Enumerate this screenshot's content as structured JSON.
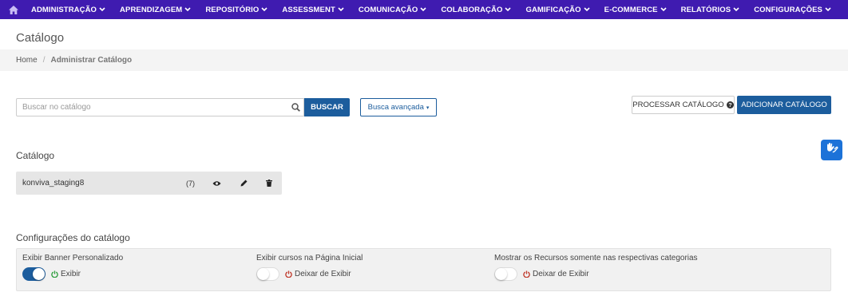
{
  "nav": {
    "items": [
      {
        "label": "ADMINISTRAÇÃO"
      },
      {
        "label": "APRENDIZAGEM"
      },
      {
        "label": "REPOSITÓRIO"
      },
      {
        "label": "ASSESSMENT"
      },
      {
        "label": "COMUNICAÇÃO"
      },
      {
        "label": "COLABORAÇÃO"
      },
      {
        "label": "GAMIFICAÇÃO"
      },
      {
        "label": "E-COMMERCE"
      },
      {
        "label": "RELATÓRIOS"
      },
      {
        "label": "CONFIGURAÇÕES"
      }
    ]
  },
  "page": {
    "title": "Catálogo"
  },
  "breadcrumb": {
    "home": "Home",
    "separator": "/",
    "current": "Administrar Catálogo"
  },
  "search": {
    "placeholder": "Buscar no catálogo",
    "value": "",
    "button_label": "BUSCAR",
    "advanced_label": "Busca avançada",
    "advanced_caret": "▾"
  },
  "actions": {
    "process_label": "PROCESSAR CATÁLOGO",
    "add_label": "ADICIONAR CATÁLOGO"
  },
  "catalog": {
    "section_title": "Catálogo",
    "items": [
      {
        "name": "konviva_staging8",
        "count": "(7)"
      }
    ]
  },
  "settings": {
    "section_title": "Configurações do catálogo",
    "items": [
      {
        "label": "Exibir Banner Personalizado",
        "state": "on",
        "state_label": "Exibir"
      },
      {
        "label": "Exibir cursos na Página Inicial",
        "state": "off",
        "state_label": "Deixar de Exibir"
      },
      {
        "label": "Mostrar os Recursos somente nas respectivas categorias",
        "state": "off",
        "state_label": "Deixar de Exibir"
      }
    ]
  },
  "colors": {
    "nav_bg": "#3f1bb0",
    "primary": "#1c5d9d",
    "accessibility": "#1c72d8",
    "on_green": "#2e9e3e",
    "off_red": "#c0392b"
  },
  "icons": {
    "home": "home-icon",
    "chevron": "chevron-down-icon",
    "search": "search-icon",
    "help": "question-circle-icon",
    "view": "eye-icon",
    "edit": "pencil-icon",
    "delete": "trash-icon",
    "power": "power-icon",
    "accessibility": "sign-language-hands-icon"
  }
}
